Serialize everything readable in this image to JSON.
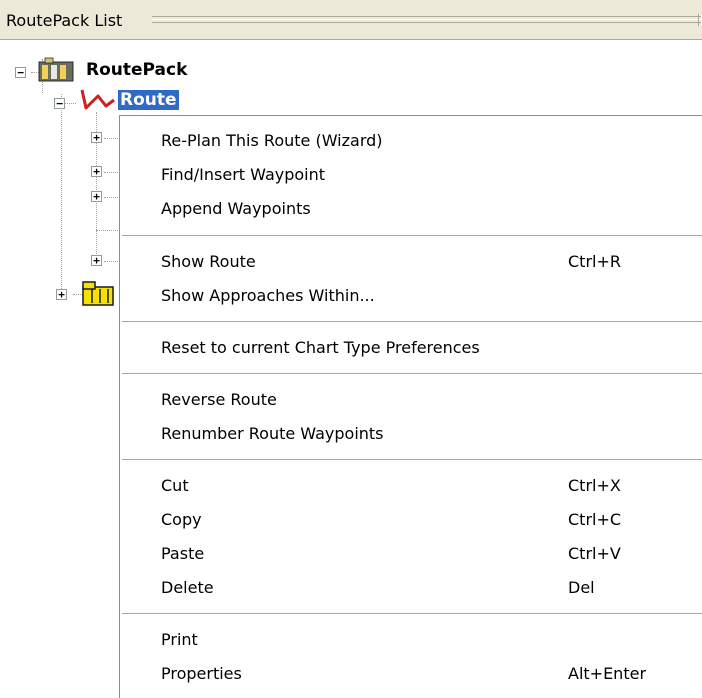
{
  "panel": {
    "title": "RoutePack List"
  },
  "tree": {
    "root_label": "RoutePack",
    "route_label": "Route",
    "collapse_glyph": "−",
    "expand_glyph": "+"
  },
  "context_menu": {
    "groups": [
      [
        {
          "label": "Re-Plan This Route (Wizard)",
          "shortcut": ""
        },
        {
          "label": "Find/Insert Waypoint",
          "shortcut": ""
        },
        {
          "label": "Append Waypoints",
          "shortcut": ""
        }
      ],
      [
        {
          "label": "Show Route",
          "shortcut": "Ctrl+R"
        },
        {
          "label": "Show Approaches Within...",
          "shortcut": ""
        }
      ],
      [
        {
          "label": "Reset to current Chart Type Preferences",
          "shortcut": ""
        }
      ],
      [
        {
          "label": "Reverse Route",
          "shortcut": ""
        },
        {
          "label": "Renumber Route Waypoints",
          "shortcut": ""
        }
      ],
      [
        {
          "label": "Cut",
          "shortcut": "Ctrl+X"
        },
        {
          "label": "Copy",
          "shortcut": "Ctrl+C"
        },
        {
          "label": "Paste",
          "shortcut": "Ctrl+V"
        },
        {
          "label": "Delete",
          "shortcut": "Del"
        }
      ],
      [
        {
          "label": "Print",
          "shortcut": ""
        },
        {
          "label": "Properties",
          "shortcut": "Alt+Enter"
        }
      ]
    ]
  },
  "colors": {
    "selection": "#316ac5",
    "panel_bg": "#ece9d8",
    "separator": "#aca899"
  },
  "icons": [
    "routepack-icon",
    "route-icon",
    "folder-icon"
  ]
}
